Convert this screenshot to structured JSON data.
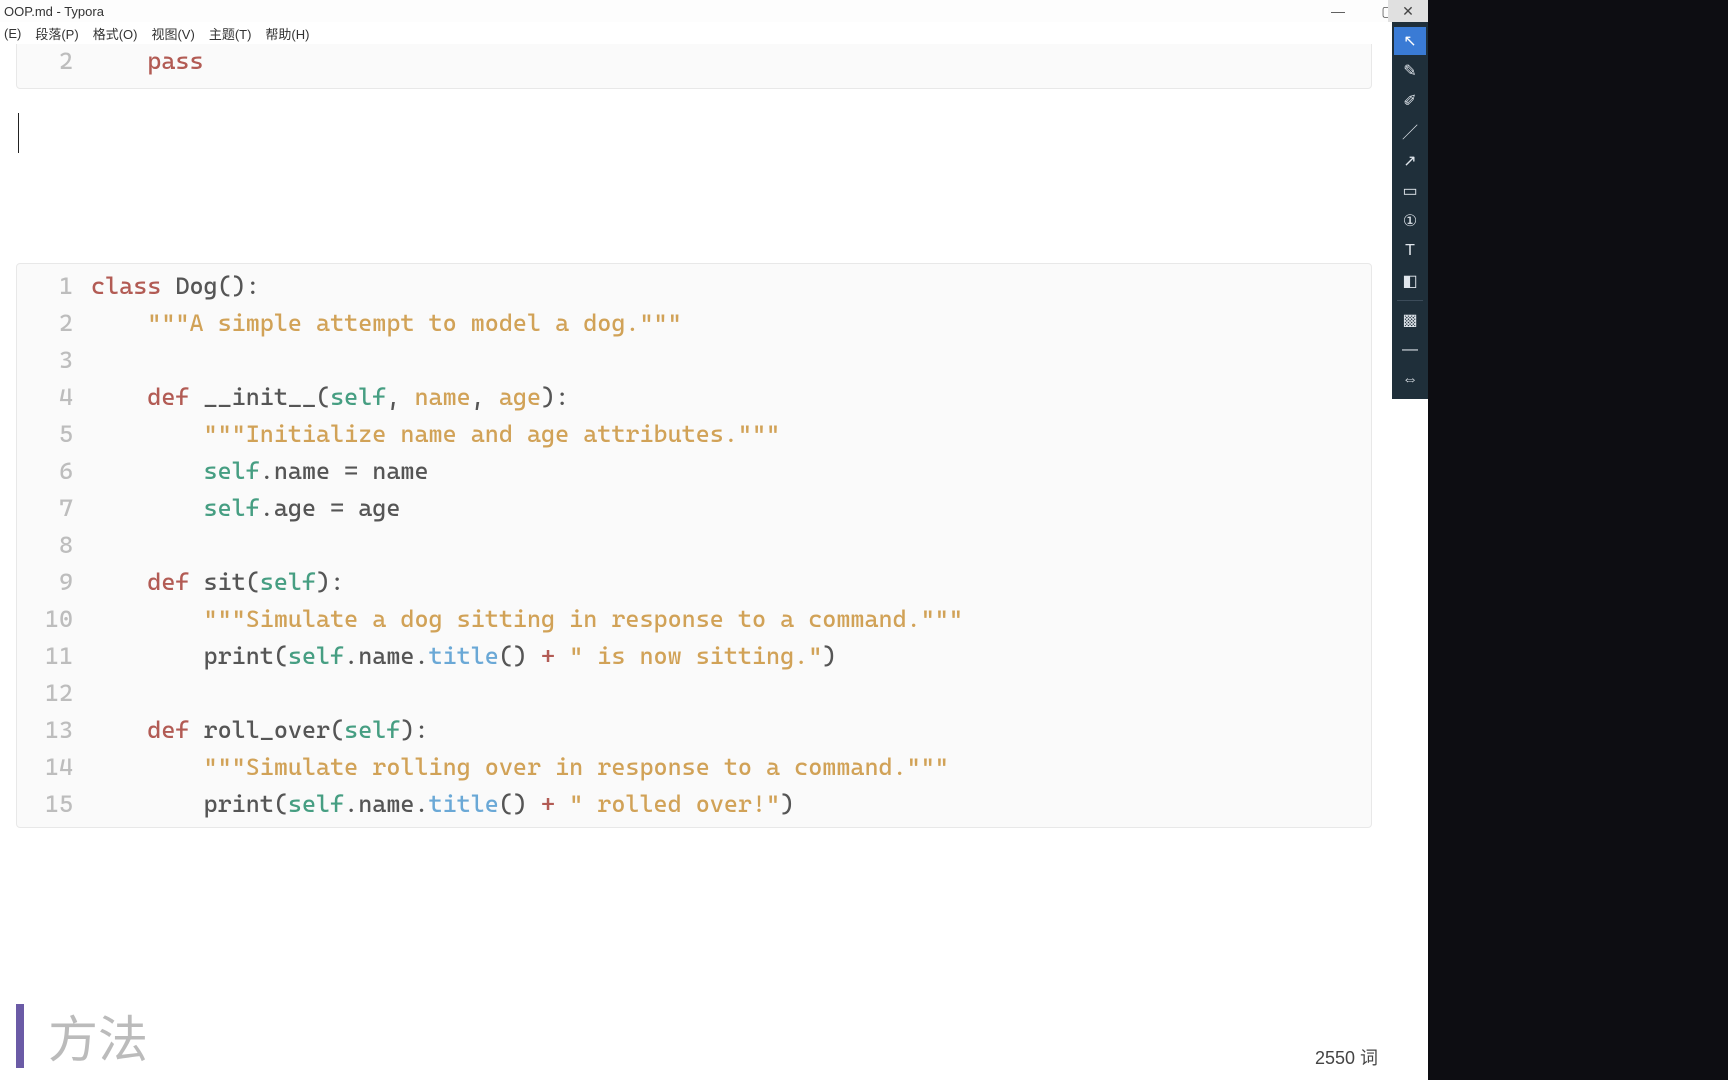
{
  "title": "OOP.md - Typora",
  "menu": [
    "(E)",
    "段落(P)",
    "格式(O)",
    "视图(V)",
    "主题(T)",
    "帮助(H)"
  ],
  "window_controls": {
    "min": "—",
    "max": "▢",
    "close": "✕"
  },
  "top_block": {
    "lines": [
      {
        "n": "2",
        "tokens": [
          {
            "t": "    ",
            "c": ""
          },
          {
            "t": "pass",
            "c": "tk-kw"
          }
        ]
      }
    ]
  },
  "main_block": {
    "lines": [
      {
        "n": "1",
        "tokens": [
          {
            "t": "class ",
            "c": "tk-kw"
          },
          {
            "t": "Dog",
            "c": "tk-cls"
          },
          {
            "t": "():",
            "c": ""
          }
        ]
      },
      {
        "n": "2",
        "tokens": [
          {
            "t": "    ",
            "c": ""
          },
          {
            "t": "\"\"\"A simple attempt to model a dog.\"\"\"",
            "c": "tk-str"
          }
        ]
      },
      {
        "n": "3",
        "tokens": []
      },
      {
        "n": "4",
        "tokens": [
          {
            "t": "    ",
            "c": ""
          },
          {
            "t": "def ",
            "c": "tk-def"
          },
          {
            "t": "__init__",
            "c": "tk-fn"
          },
          {
            "t": "(",
            "c": ""
          },
          {
            "t": "self",
            "c": "tk-self"
          },
          {
            "t": ", ",
            "c": ""
          },
          {
            "t": "name",
            "c": "tk-arg"
          },
          {
            "t": ", ",
            "c": ""
          },
          {
            "t": "age",
            "c": "tk-arg"
          },
          {
            "t": "):",
            "c": ""
          }
        ]
      },
      {
        "n": "5",
        "tokens": [
          {
            "t": "        ",
            "c": ""
          },
          {
            "t": "\"\"\"Initialize name and age attributes.\"\"\"",
            "c": "tk-str"
          }
        ]
      },
      {
        "n": "6",
        "tokens": [
          {
            "t": "        ",
            "c": ""
          },
          {
            "t": "self",
            "c": "tk-self"
          },
          {
            "t": ".name = name",
            "c": ""
          }
        ]
      },
      {
        "n": "7",
        "tokens": [
          {
            "t": "        ",
            "c": ""
          },
          {
            "t": "self",
            "c": "tk-self"
          },
          {
            "t": ".age = age",
            "c": ""
          }
        ]
      },
      {
        "n": "8",
        "tokens": []
      },
      {
        "n": "9",
        "tokens": [
          {
            "t": "    ",
            "c": ""
          },
          {
            "t": "def ",
            "c": "tk-def"
          },
          {
            "t": "sit",
            "c": "tk-fn"
          },
          {
            "t": "(",
            "c": ""
          },
          {
            "t": "self",
            "c": "tk-self"
          },
          {
            "t": "):",
            "c": ""
          }
        ]
      },
      {
        "n": "10",
        "tokens": [
          {
            "t": "        ",
            "c": ""
          },
          {
            "t": "\"\"\"Simulate a dog sitting in response to a command.\"\"\"",
            "c": "tk-str"
          }
        ]
      },
      {
        "n": "11",
        "tokens": [
          {
            "t": "        ",
            "c": ""
          },
          {
            "t": "print(",
            "c": ""
          },
          {
            "t": "self",
            "c": "tk-self"
          },
          {
            "t": ".name.",
            "c": ""
          },
          {
            "t": "title",
            "c": "tk-call"
          },
          {
            "t": "() ",
            "c": ""
          },
          {
            "t": "+",
            "c": "tk-plus"
          },
          {
            "t": " ",
            "c": ""
          },
          {
            "t": "\" is now sitting.\"",
            "c": "tk-str"
          },
          {
            "t": ")",
            "c": ""
          }
        ]
      },
      {
        "n": "12",
        "tokens": []
      },
      {
        "n": "13",
        "tokens": [
          {
            "t": "    ",
            "c": ""
          },
          {
            "t": "def ",
            "c": "tk-def"
          },
          {
            "t": "roll_over",
            "c": "tk-fn"
          },
          {
            "t": "(",
            "c": ""
          },
          {
            "t": "self",
            "c": "tk-self"
          },
          {
            "t": "):",
            "c": ""
          }
        ]
      },
      {
        "n": "14",
        "tokens": [
          {
            "t": "        ",
            "c": ""
          },
          {
            "t": "\"\"\"Simulate rolling over in response to a command.\"\"\"",
            "c": "tk-str"
          }
        ]
      },
      {
        "n": "15",
        "tokens": [
          {
            "t": "        ",
            "c": ""
          },
          {
            "t": "print(",
            "c": ""
          },
          {
            "t": "self",
            "c": "tk-self"
          },
          {
            "t": ".name.",
            "c": ""
          },
          {
            "t": "title",
            "c": "tk-call"
          },
          {
            "t": "() ",
            "c": ""
          },
          {
            "t": "+",
            "c": "tk-plus"
          },
          {
            "t": " ",
            "c": ""
          },
          {
            "t": "\" rolled over!\"",
            "c": "tk-str"
          },
          {
            "t": ")",
            "c": ""
          }
        ]
      }
    ]
  },
  "heading": "方法",
  "wordcount": "2550 词",
  "tools": [
    {
      "name": "cursor-icon",
      "glyph": "↖",
      "active": true
    },
    {
      "name": "pen-icon",
      "glyph": "✎"
    },
    {
      "name": "highlighter-icon",
      "glyph": "✐"
    },
    {
      "name": "line-icon",
      "glyph": "／"
    },
    {
      "name": "arrow-icon",
      "glyph": "↗"
    },
    {
      "name": "rect-icon",
      "glyph": "▭"
    },
    {
      "name": "number-icon",
      "glyph": "①"
    },
    {
      "name": "text-icon",
      "glyph": "T"
    },
    {
      "name": "eraser-icon",
      "glyph": "◧"
    },
    {
      "name": "sep",
      "glyph": ""
    },
    {
      "name": "blur-icon",
      "glyph": "▩"
    },
    {
      "name": "minus-icon",
      "glyph": "—"
    },
    {
      "name": "resize-icon",
      "glyph": "⇔"
    }
  ]
}
